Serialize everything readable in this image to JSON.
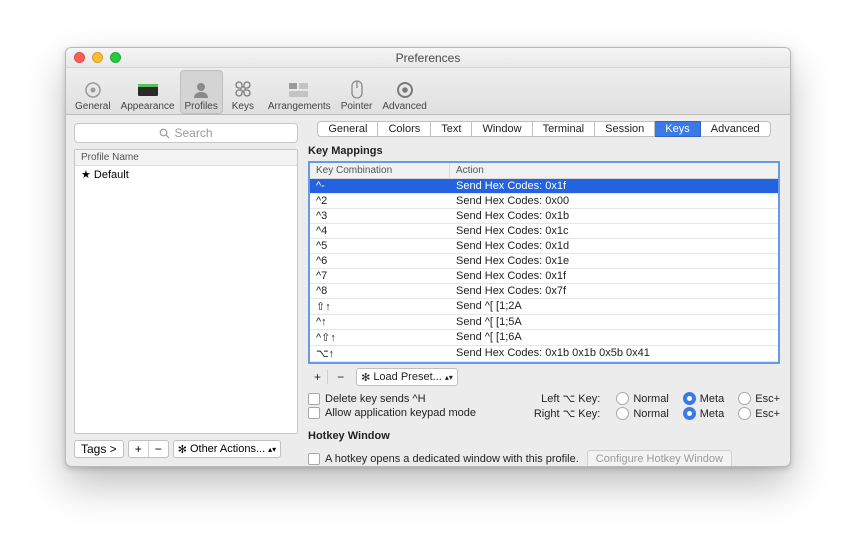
{
  "window": {
    "title": "Preferences"
  },
  "toolbar": {
    "items": [
      {
        "label": "General"
      },
      {
        "label": "Appearance"
      },
      {
        "label": "Profiles"
      },
      {
        "label": "Keys"
      },
      {
        "label": "Arrangements"
      },
      {
        "label": "Pointer"
      },
      {
        "label": "Advanced"
      }
    ],
    "selected_index": 2
  },
  "left": {
    "search_placeholder": "Search",
    "profile_header": "Profile Name",
    "profile_default": "★ Default",
    "tags_label": "Tags >",
    "other_actions": "Other Actions...",
    "plus": "+",
    "minus": "−"
  },
  "subtabs": {
    "items": [
      "General",
      "Colors",
      "Text",
      "Window",
      "Terminal",
      "Session",
      "Keys",
      "Advanced"
    ],
    "selected_index": 6
  },
  "keymappings": {
    "title": "Key Mappings",
    "col1": "Key Combination",
    "col2": "Action",
    "rows": [
      {
        "k": "^-",
        "a": "Send Hex Codes: 0x1f",
        "sel": true
      },
      {
        "k": "^2",
        "a": "Send Hex Codes: 0x00"
      },
      {
        "k": "^3",
        "a": "Send Hex Codes: 0x1b"
      },
      {
        "k": "^4",
        "a": "Send Hex Codes: 0x1c"
      },
      {
        "k": "^5",
        "a": "Send Hex Codes: 0x1d"
      },
      {
        "k": "^6",
        "a": "Send Hex Codes: 0x1e"
      },
      {
        "k": "^7",
        "a": "Send Hex Codes: 0x1f"
      },
      {
        "k": "^8",
        "a": "Send Hex Codes: 0x7f"
      },
      {
        "k": "⇧↑",
        "a": "Send ^[ [1;2A"
      },
      {
        "k": "^↑",
        "a": "Send ^[ [1;5A"
      },
      {
        "k": "^⇧↑",
        "a": "Send ^[ [1;6A"
      },
      {
        "k": "⌥↑",
        "a": "Send Hex Codes: 0x1b 0x1b 0x5b 0x41"
      }
    ],
    "load_preset": "Load Preset...",
    "plus": "+",
    "minus": "−"
  },
  "options": {
    "delete_label": "Delete key sends ^H",
    "keypad_label": "Allow application keypad mode",
    "left_opt_label": "Left ⌥  Key:",
    "right_opt_label": "Right ⌥  Key:",
    "normal": "Normal",
    "meta": "Meta",
    "escplus": "Esc+"
  },
  "hotkey": {
    "title": "Hotkey Window",
    "chk_label": "A hotkey opens a dedicated window with this profile.",
    "button": "Configure Hotkey Window"
  }
}
